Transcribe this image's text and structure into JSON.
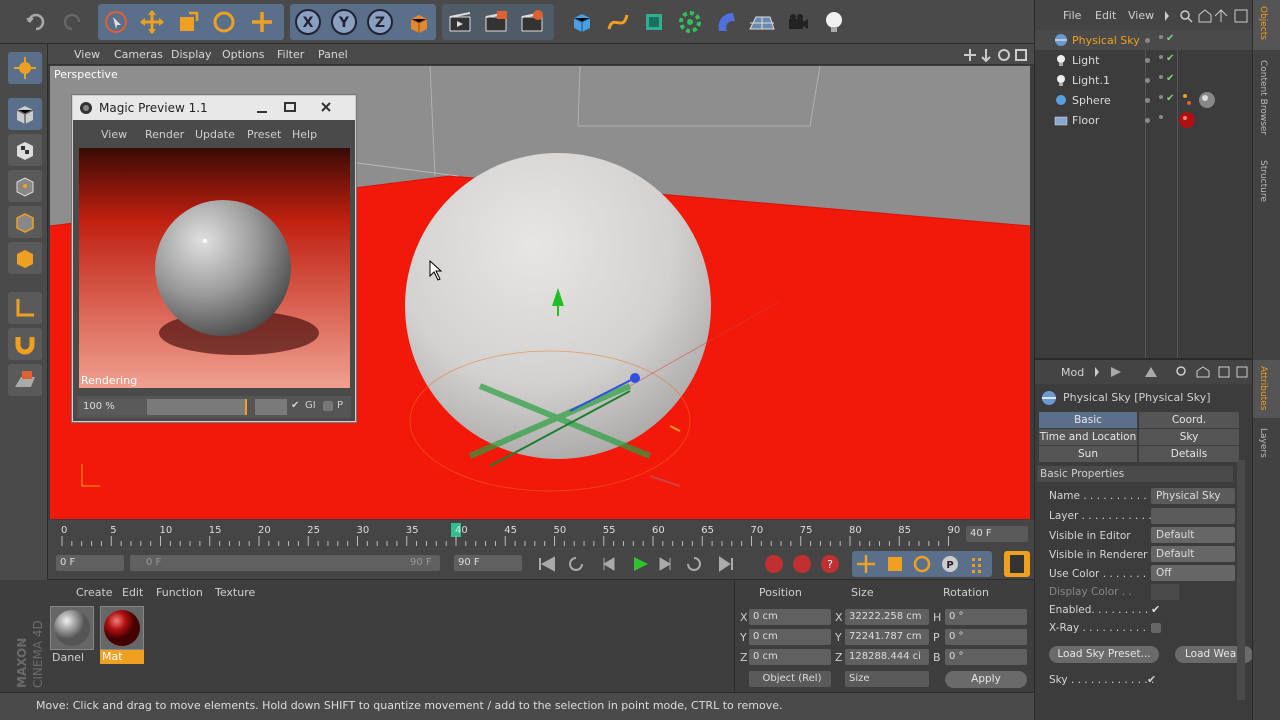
{
  "toolbar": {
    "icons": [
      "undo-icon",
      "redo-icon",
      "live-select-icon",
      "move-icon",
      "scale-icon",
      "rotate-icon",
      "add-icon",
      "x-axis-icon",
      "y-axis-icon",
      "z-axis-icon",
      "coordinate-system-icon",
      "render-view-icon",
      "render-picture-viewer-icon",
      "render-settings-icon",
      "cube-icon",
      "spline-icon",
      "nurbs-icon",
      "array-icon",
      "deformer-icon",
      "floor-icon",
      "camera-icon",
      "light-icon"
    ],
    "axis_x": "X",
    "axis_y": "Y",
    "axis_z": "Z"
  },
  "viewport_menu": {
    "items": [
      "View",
      "Cameras",
      "Display",
      "Options",
      "Filter",
      "Panel"
    ],
    "view_label": "Perspective"
  },
  "magic_preview": {
    "title": "Magic Preview 1.1",
    "menu": [
      "View",
      "Render",
      "Update",
      "Preset",
      "Help"
    ],
    "status": "Rendering",
    "zoom": "100 %",
    "gi_label": "GI",
    "p_label": "P"
  },
  "timeline": {
    "ticks": [
      "0",
      "5",
      "10",
      "15",
      "20",
      "25",
      "30",
      "35",
      "40",
      "45",
      "50",
      "55",
      "60",
      "65",
      "70",
      "75",
      "80",
      "85",
      "90"
    ],
    "current_frame": 40,
    "current_field": "40 F",
    "start_field": "0 F",
    "range_start": "0 F",
    "range_end": "90 F",
    "end_field": "90 F"
  },
  "materials": {
    "menu": [
      "Create",
      "Edit",
      "Function",
      "Texture"
    ],
    "items": [
      {
        "name": "Danel",
        "selected": false
      },
      {
        "name": "Mat",
        "selected": true
      }
    ],
    "brand_top": "MAXON",
    "brand_bottom": "CINEMA 4D"
  },
  "coords": {
    "headers": [
      "Position",
      "Size",
      "Rotation"
    ],
    "rows": [
      {
        "axis": "X",
        "pos": "0 cm",
        "size_axis": "X",
        "size": "32222.258 cm",
        "rot_axis": "H",
        "rot": "0 °"
      },
      {
        "axis": "Y",
        "pos": "0 cm",
        "size_axis": "Y",
        "size": "72241.787 cm",
        "rot_axis": "P",
        "rot": "0 °"
      },
      {
        "axis": "Z",
        "pos": "0 cm",
        "size_axis": "Z",
        "size": "128288.444 ci",
        "rot_axis": "B",
        "rot": "0 °"
      }
    ],
    "mode": "Object (Rel)",
    "size_mode": "Size",
    "apply": "Apply"
  },
  "status_bar": {
    "text": "Move: Click and drag to move elements. Hold down SHIFT to quantize movement / add to the selection in point mode, CTRL to remove."
  },
  "objects": {
    "menu": [
      "File",
      "Edit",
      "View"
    ],
    "items": [
      {
        "name": "Physical Sky",
        "selected": true
      },
      {
        "name": "Light",
        "selected": false
      },
      {
        "name": "Light.1",
        "selected": false
      },
      {
        "name": "Sphere",
        "selected": false
      },
      {
        "name": "Floor",
        "selected": false
      }
    ]
  },
  "attributes": {
    "menu_mode": "Mod",
    "title": "Physical Sky [Physical Sky]",
    "tabs": [
      [
        "Basic",
        "Coord."
      ],
      [
        "Time and Location",
        "Sky"
      ],
      [
        "Sun",
        "Details"
      ]
    ],
    "section": "Basic Properties",
    "props": [
      {
        "label": "Name . . . . . . . . . . .",
        "value": "Physical Sky"
      },
      {
        "label": "Layer . . . . . . . . . . .",
        "value": ""
      },
      {
        "label": "Visible in Editor",
        "value": "Default"
      },
      {
        "label": "Visible in Renderer",
        "value": "Default"
      },
      {
        "label": "Use Color . . . . . . .",
        "value": "Off"
      },
      {
        "label": "Display Color . .",
        "value": ""
      },
      {
        "label": "Enabled. . . . . . . . .",
        "value": "✔"
      },
      {
        "label": "X-Ray . . . . . . . . . .",
        "value": ""
      }
    ],
    "buttons": [
      "Load Sky Preset...",
      "Load Wea"
    ],
    "sky_label": "Sky . . . . . . . . . . . . .",
    "sky_value": "✔"
  },
  "side_tabs": [
    "Objects",
    "Content Browser",
    "Structure",
    "Attributes",
    "Layers"
  ]
}
